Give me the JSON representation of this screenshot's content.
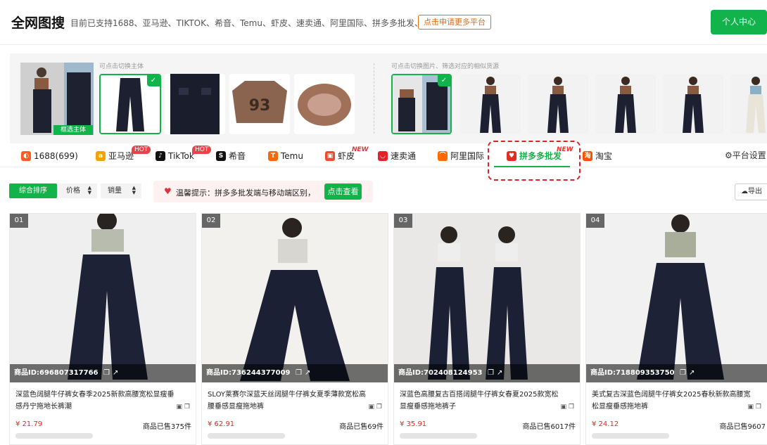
{
  "header": {
    "title": "全网图搜",
    "subtitle": "目前已支持1688、亚马逊、TIKTOK、希音、Temu、虾皮、速卖通、阿里国际、拼多多批发、淘宝",
    "apply_label": "点击申请更多平台",
    "personal_center_label": "个人中心"
  },
  "image_strip": {
    "left_hint": "可点击切换主体",
    "right_hint": "可点击切换图片、筛选对应的相似货源",
    "frame_select_label": "框选主体"
  },
  "tabs": [
    {
      "label": "1688(699)",
      "icon": "1688-icon",
      "color": "#ff5a1f"
    },
    {
      "label": "亚马逊",
      "icon": "amazon-icon",
      "color": "#f5a100",
      "badge": "HOT"
    },
    {
      "label": "TikTok",
      "icon": "tiktok-icon",
      "color": "#111111",
      "badge": "HOT"
    },
    {
      "label": "希音",
      "icon": "shein-icon",
      "color": "#111111"
    },
    {
      "label": "Temu",
      "icon": "temu-icon",
      "color": "#f26a10"
    },
    {
      "label": "虾皮",
      "icon": "shopee-icon",
      "color": "#ee4d2d",
      "badge": "NEW"
    },
    {
      "label": "速卖通",
      "icon": "aliexpress-icon",
      "color": "#e6212a"
    },
    {
      "label": "阿里国际",
      "icon": "alibaba-icon",
      "color": "#ff6a00"
    },
    {
      "label": "拼多多批发",
      "icon": "pinduoduo-icon",
      "color": "#e02e24",
      "badge": "NEW",
      "active": true
    },
    {
      "label": "淘宝",
      "icon": "taobao-icon",
      "color": "#ff5000"
    }
  ],
  "platform_settings_label": "平台设置",
  "sort": {
    "comprehensive_label": "综合排序",
    "price_label": "价格",
    "sales_label": "销量"
  },
  "tip": {
    "text": "温馨提示：拼多多批发端与移动端区别，",
    "button_label": "点击查看"
  },
  "export_label": "导出",
  "products": [
    {
      "index": "01",
      "id": "商品ID:696807317766",
      "title": "深蓝色阔腿牛仔裤女春季2025新款高腰宽松显瘦垂感丹宁拖地长裤潮",
      "price": "¥ 21.79",
      "sold": "商品已售375件"
    },
    {
      "index": "02",
      "id": "商品ID:736244377009",
      "title": "SLOY莱赛尔深蓝天丝阔腿牛仔裤女夏季薄款宽松高腰垂感显瘦拖地裤",
      "price": "¥ 62.91",
      "sold": "商品已售69件"
    },
    {
      "index": "03",
      "id": "商品ID:702408124953",
      "title": "深蓝色高腰复古百搭阔腿牛仔裤女春夏2025款宽松显瘦垂感拖地裤子",
      "price": "¥ 35.91",
      "sold": "商品已售6017件"
    },
    {
      "index": "04",
      "id": "商品ID:718809353750",
      "title": "美式复古深蓝色阔腿牛仔裤女2025春秋新款高腰宽松显瘦垂感拖地裤",
      "price": "¥ 24.12",
      "sold": "商品已售9607"
    }
  ],
  "colors": {
    "accent": "#12b34a",
    "price": "#ee2222",
    "highlight": "#d9232e"
  }
}
